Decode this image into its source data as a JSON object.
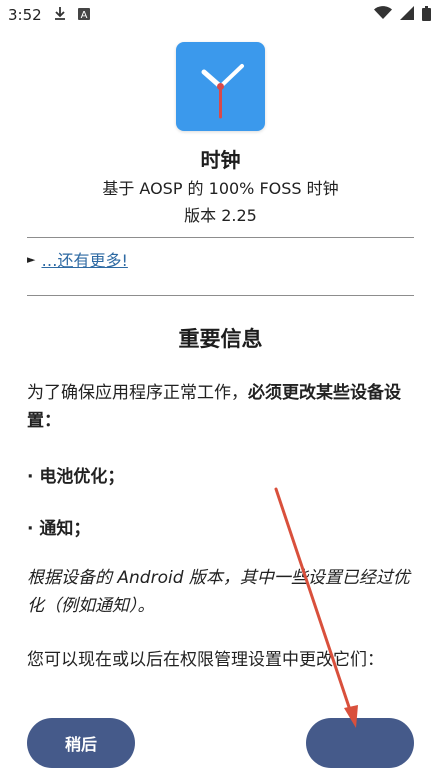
{
  "status_bar": {
    "time": "3:52",
    "icons_left": [
      "download-icon",
      "a-box-icon"
    ],
    "icons_right": [
      "wifi-icon",
      "signal-icon",
      "battery-icon"
    ]
  },
  "app": {
    "name": "时钟",
    "description": "基于 AOSP 的 100% FOSS 时钟",
    "version": "版本 2.25",
    "icon_color": "#3b99ec"
  },
  "more_link": "…还有更多!",
  "section_title": "重要信息",
  "paragraph1": {
    "normal": "为了确保应用程序正常工作，",
    "bold": "必须更改某些设备设置："
  },
  "bullets": [
    "· 电池优化；",
    "· 通知；"
  ],
  "paragraph2": "根据设备的 Android 版本，其中一些设置已经过优化（例如通知）。",
  "paragraph3": "您可以现在或以后在权限管理设置中更改它们：",
  "buttons": {
    "later": "稍后"
  },
  "colors": {
    "button": "#455a8a",
    "link": "#2e6aa3",
    "annotation_arrow": "#d9503c"
  }
}
